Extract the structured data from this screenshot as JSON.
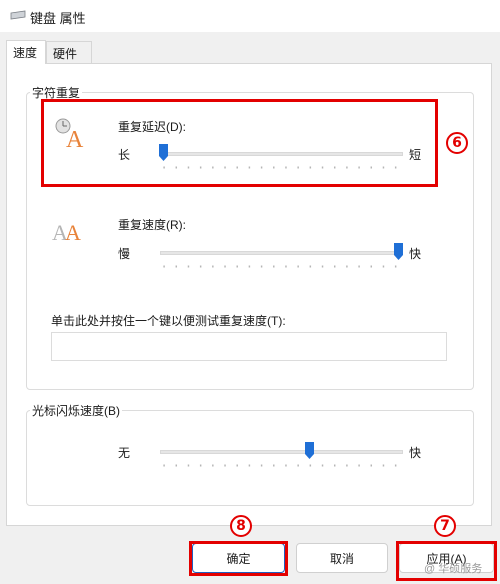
{
  "window": {
    "title": "键盘 属性"
  },
  "tabs": [
    {
      "label": "速度",
      "active": true
    },
    {
      "label": "硬件",
      "active": false
    }
  ],
  "repeat_group": {
    "legend": "字符重复",
    "delay": {
      "label": "重复延迟(D):",
      "left": "长",
      "right": "短",
      "value": 0
    },
    "rate": {
      "label": "重复速度(R):",
      "left": "慢",
      "right": "快",
      "value": 1
    },
    "test_label": "单击此处并按住一个键以便测试重复速度(T):",
    "test_value": ""
  },
  "cursor_group": {
    "legend": "光标闪烁速度(B)",
    "left": "无",
    "right": "快",
    "value": 0.62
  },
  "buttons": {
    "ok": "确定",
    "cancel": "取消",
    "apply": "应用(A)"
  },
  "annotations": {
    "m6": "6",
    "m7": "7",
    "m8": "8"
  },
  "watermark": "@ 华硕服务",
  "colors": {
    "annotation_red": "#e30000",
    "slider_thumb": "#1f6fd6",
    "icon_orange": "#e8833a"
  }
}
